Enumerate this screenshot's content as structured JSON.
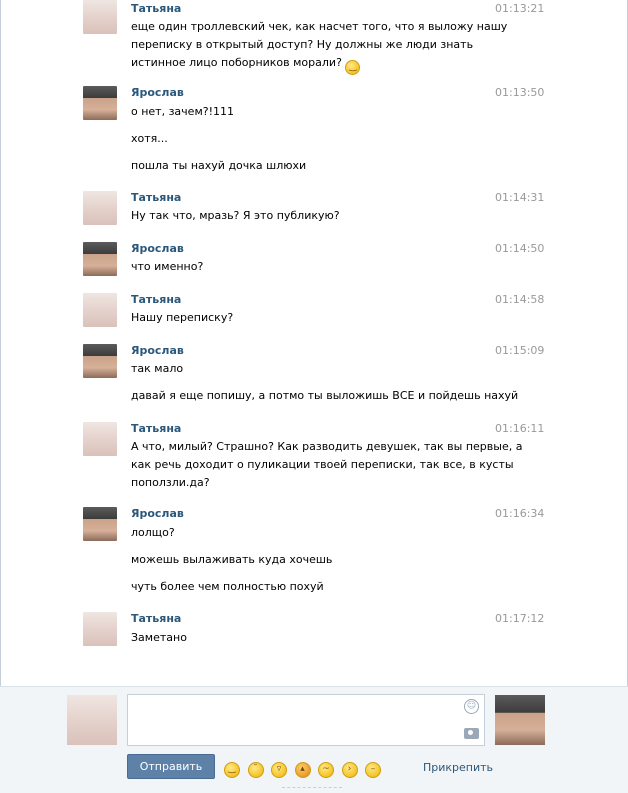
{
  "authors": {
    "tatyana": "Татьяна",
    "yaroslav": "Ярослав"
  },
  "messages": [
    {
      "author": "Татьяна",
      "time": "01:13:21",
      "lines": [
        "еще один троллевский чек, как насчет того, что я выложу нашу",
        "переписку в открытый доступ? Ну должны же люди знать",
        "истинное лицо поборников морали?"
      ]
    },
    {
      "author": "Ярослав",
      "time": "01:13:50",
      "lines": [
        "о нет, зачем?!111",
        "хотя...",
        "пошла ты нахуй дочка шлюхи"
      ]
    },
    {
      "author": "Татьяна",
      "time": "01:14:31",
      "lines": [
        "Ну так что, мразь? Я это публикую?"
      ]
    },
    {
      "author": "Ярослав",
      "time": "01:14:50",
      "lines": [
        "что именно?"
      ]
    },
    {
      "author": "Татьяна",
      "time": "01:14:58",
      "lines": [
        "Нашу переписку?"
      ]
    },
    {
      "author": "Ярослав",
      "time": "01:15:09",
      "lines": [
        "так мало",
        "давай я еще попишу, а потмо ты выложишь ВСЕ и пойдешь нахуй"
      ]
    },
    {
      "author": "Татьяна",
      "time": "01:16:11",
      "lines": [
        "А что, милый? Страшно? Как разводить девушек, так вы первые, а",
        "как речь доходит о пуликации твоей переписки, так все, в кусты",
        "поползли.да?"
      ]
    },
    {
      "author": "Ярослав",
      "time": "01:16:34",
      "lines": [
        "лолщо?",
        "можешь вылаживать куда хочешь",
        "чуть более чем полностью похуй"
      ]
    },
    {
      "author": "Татьяна",
      "time": "01:17:12",
      "lines": [
        "Заметано"
      ]
    }
  ],
  "composer": {
    "placeholder": "",
    "send_label": "Отправить",
    "attach_label": "Прикрепить",
    "emoji_icons": [
      "smile-icon",
      "blush-icon",
      "laugh-icon",
      "angry-icon",
      "confused-icon",
      "wink-icon",
      "neutral-icon"
    ]
  }
}
